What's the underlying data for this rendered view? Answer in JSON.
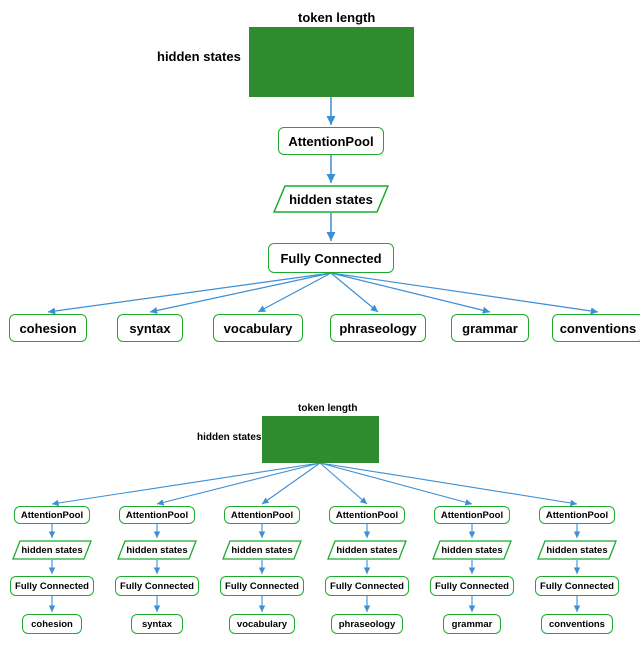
{
  "top": {
    "token_label": "token length",
    "hidden_label": "hidden states",
    "attention_pool": "AttentionPool",
    "hidden_states_para": "hidden states",
    "fully_connected": "Fully Connected",
    "outputs": [
      "cohesion",
      "syntax",
      "vocabulary",
      "phraseology",
      "grammar",
      "conventions"
    ]
  },
  "bottom": {
    "token_label": "token length",
    "hidden_label": "hidden states",
    "columns": [
      {
        "ap": "AttentionPool",
        "hs": "hidden states",
        "fc": "Fully Connected",
        "out": "cohesion"
      },
      {
        "ap": "AttentionPool",
        "hs": "hidden states",
        "fc": "Fully Connected",
        "out": "syntax"
      },
      {
        "ap": "AttentionPool",
        "hs": "hidden states",
        "fc": "Fully Connected",
        "out": "vocabulary"
      },
      {
        "ap": "AttentionPool",
        "hs": "hidden states",
        "fc": "Fully Connected",
        "out": "phraseology"
      },
      {
        "ap": "AttentionPool",
        "hs": "hidden states",
        "fc": "Fully Connected",
        "out": "grammar"
      },
      {
        "ap": "AttentionPool",
        "hs": "hidden states",
        "fc": "Fully Connected",
        "out": "conventions"
      }
    ]
  }
}
